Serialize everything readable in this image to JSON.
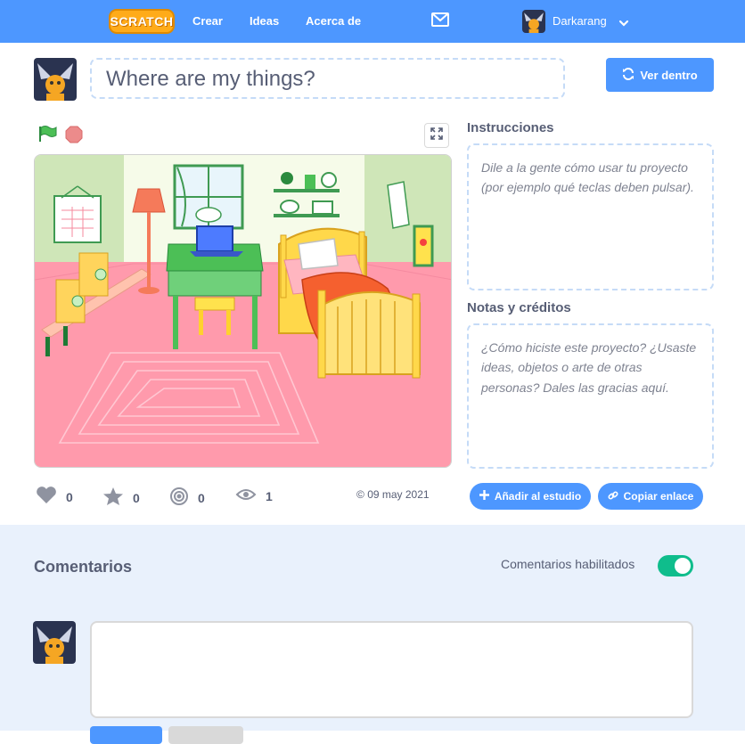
{
  "nav": {
    "logo": "SCRATCH",
    "links": [
      "Crear",
      "Ideas",
      "Acerca de"
    ],
    "user_name": "Darkarang",
    "icons": [
      "mail-icon",
      "chevron-down-icon"
    ]
  },
  "project": {
    "title": "Where are my things?",
    "see_inside_label": "Ver dentro"
  },
  "sidebar": {
    "instructions_heading": "Instrucciones",
    "instructions_placeholder": "Dile a la gente cómo usar tu proyecto (por ejemplo qué teclas deben pulsar).",
    "notes_heading": "Notas y créditos",
    "notes_placeholder": "¿Cómo hiciste este proyecto? ¿Usaste ideas, objetos o arte de otras personas? Dales las gracias aquí."
  },
  "stats": {
    "loves": "0",
    "favorites": "0",
    "remixes": "0",
    "views": "1",
    "shared_date": "09 may 2021"
  },
  "actions": {
    "add_to_studio": "Añadir al estudio",
    "copy_link": "Copiar enlace"
  },
  "comments": {
    "title": "Comentarios",
    "enabled_label": "Comentarios habilitados",
    "enabled": true
  },
  "colors": {
    "brand_blue": "#4d97ff",
    "toggle_on": "#0fbd8c",
    "comments_bg": "#e9f1fc",
    "stage_floor": "#ff95a6"
  }
}
